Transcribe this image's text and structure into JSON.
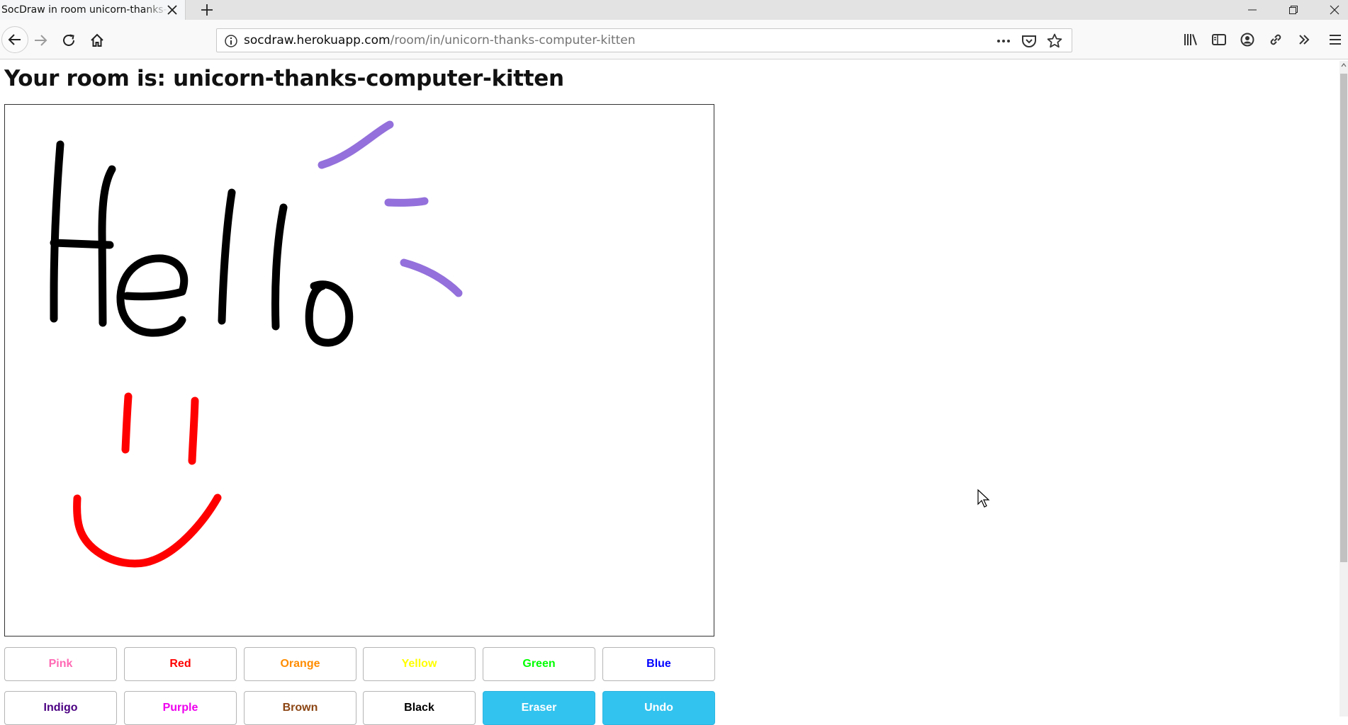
{
  "browser": {
    "tab_title": "SocDraw in room unicorn-thanks-computer-kitten",
    "url_domain": "socdraw.herokuapp.com",
    "url_path": "/room/in/unicorn-thanks-computer-kitten"
  },
  "page": {
    "room_title": "Your room is: unicorn-thanks-computer-kitten"
  },
  "drawing": {
    "strokes": [
      {
        "color": "#000000",
        "label": "H left stroke"
      },
      {
        "color": "#000000",
        "label": "H right stroke"
      },
      {
        "color": "#000000",
        "label": "H crossbar"
      },
      {
        "color": "#000000",
        "label": "e"
      },
      {
        "color": "#000000",
        "label": "first l"
      },
      {
        "color": "#000000",
        "label": "second l"
      },
      {
        "color": "#000000",
        "label": "o"
      },
      {
        "color": "#9370db",
        "label": "purple upper"
      },
      {
        "color": "#9370db",
        "label": "purple middle"
      },
      {
        "color": "#9370db",
        "label": "purple lower"
      },
      {
        "color": "#ff0000",
        "label": "left eye"
      },
      {
        "color": "#ff0000",
        "label": "right eye"
      },
      {
        "color": "#ff0000",
        "label": "smile"
      }
    ]
  },
  "color_buttons": [
    {
      "label": "Pink",
      "color": "#ff69b4"
    },
    {
      "label": "Red",
      "color": "#ff0000"
    },
    {
      "label": "Orange",
      "color": "#ff8c00"
    },
    {
      "label": "Yellow",
      "color": "#ffff00"
    },
    {
      "label": "Green",
      "color": "#00ff00"
    },
    {
      "label": "Blue",
      "color": "#0000ff"
    },
    {
      "label": "Indigo",
      "color": "#4b0082"
    },
    {
      "label": "Purple",
      "color": "#ee00ee"
    },
    {
      "label": "Brown",
      "color": "#8b4513"
    },
    {
      "label": "Black",
      "color": "#000000"
    }
  ],
  "action_buttons": {
    "eraser": "Eraser",
    "undo": "Undo"
  }
}
